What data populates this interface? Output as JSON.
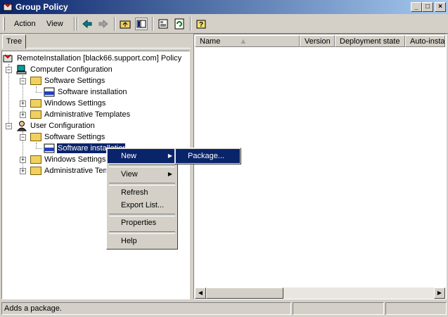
{
  "window": {
    "title": "Group Policy"
  },
  "menubar": {
    "action": "Action",
    "view": "View"
  },
  "toolbar": {
    "icons": [
      "back-icon",
      "forward-icon",
      "up-folder-icon",
      "show-hide-tree-icon",
      "properties-icon",
      "refresh-icon",
      "help-icon"
    ]
  },
  "tree": {
    "tab_label": "Tree",
    "root": "RemoteInstallation [black66.support.com] Policy",
    "items": [
      {
        "label": "Computer Configuration"
      },
      {
        "label": "Software Settings"
      },
      {
        "label": "Software installation"
      },
      {
        "label": "Windows Settings"
      },
      {
        "label": "Administrative Templates"
      },
      {
        "label": "User Configuration"
      },
      {
        "label": "Software Settings"
      },
      {
        "label": "Software installation"
      },
      {
        "label": "Windows Settings"
      },
      {
        "label": "Administrative Templates"
      }
    ]
  },
  "list": {
    "columns": [
      "Name",
      "Version",
      "Deployment state",
      "Auto-instal"
    ]
  },
  "context_menu": {
    "items": [
      "New",
      "View",
      "Refresh",
      "Export List...",
      "Properties",
      "Help"
    ]
  },
  "submenu": {
    "items": [
      "Package..."
    ]
  },
  "status": {
    "text": "Adds a package."
  },
  "colors": {
    "titlebar": "#0a246a",
    "highlight": "#0a246a",
    "face": "#d4d0c8"
  }
}
